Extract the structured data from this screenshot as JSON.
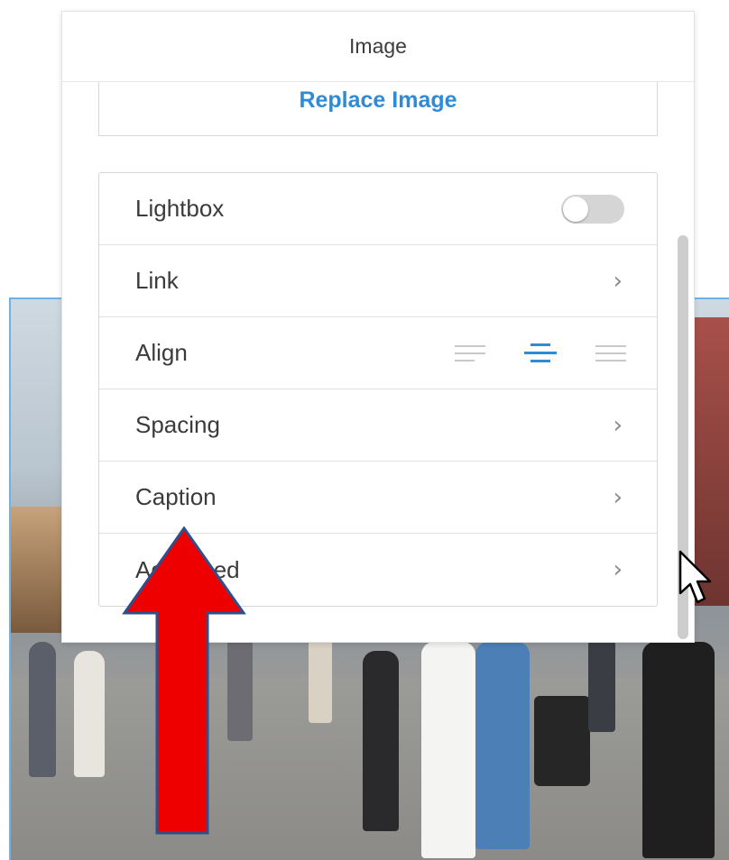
{
  "panel": {
    "title": "Image",
    "replace_label": "Replace Image"
  },
  "settings": [
    {
      "label": "Lightbox",
      "control": "toggle",
      "toggle_on": false
    },
    {
      "label": "Link",
      "control": "chevron"
    },
    {
      "label": "Align",
      "control": "align",
      "align_options": [
        "left",
        "center",
        "right"
      ],
      "selected": "center"
    },
    {
      "label": "Spacing",
      "control": "chevron"
    },
    {
      "label": "Caption",
      "control": "chevron"
    },
    {
      "label": "Advanced",
      "control": "chevron"
    }
  ],
  "icons": {
    "chevron": "chevron-right-icon",
    "align_left": "align-left-icon",
    "align_center": "align-center-icon",
    "align_right": "align-right-icon",
    "cursor": "mouse-pointer-icon",
    "annotation": "red-up-arrow-icon"
  },
  "colors": {
    "accent": "#2e8bd6",
    "annotation_arrow": "#ee0000",
    "toggle_off": "#d5d5d5"
  }
}
